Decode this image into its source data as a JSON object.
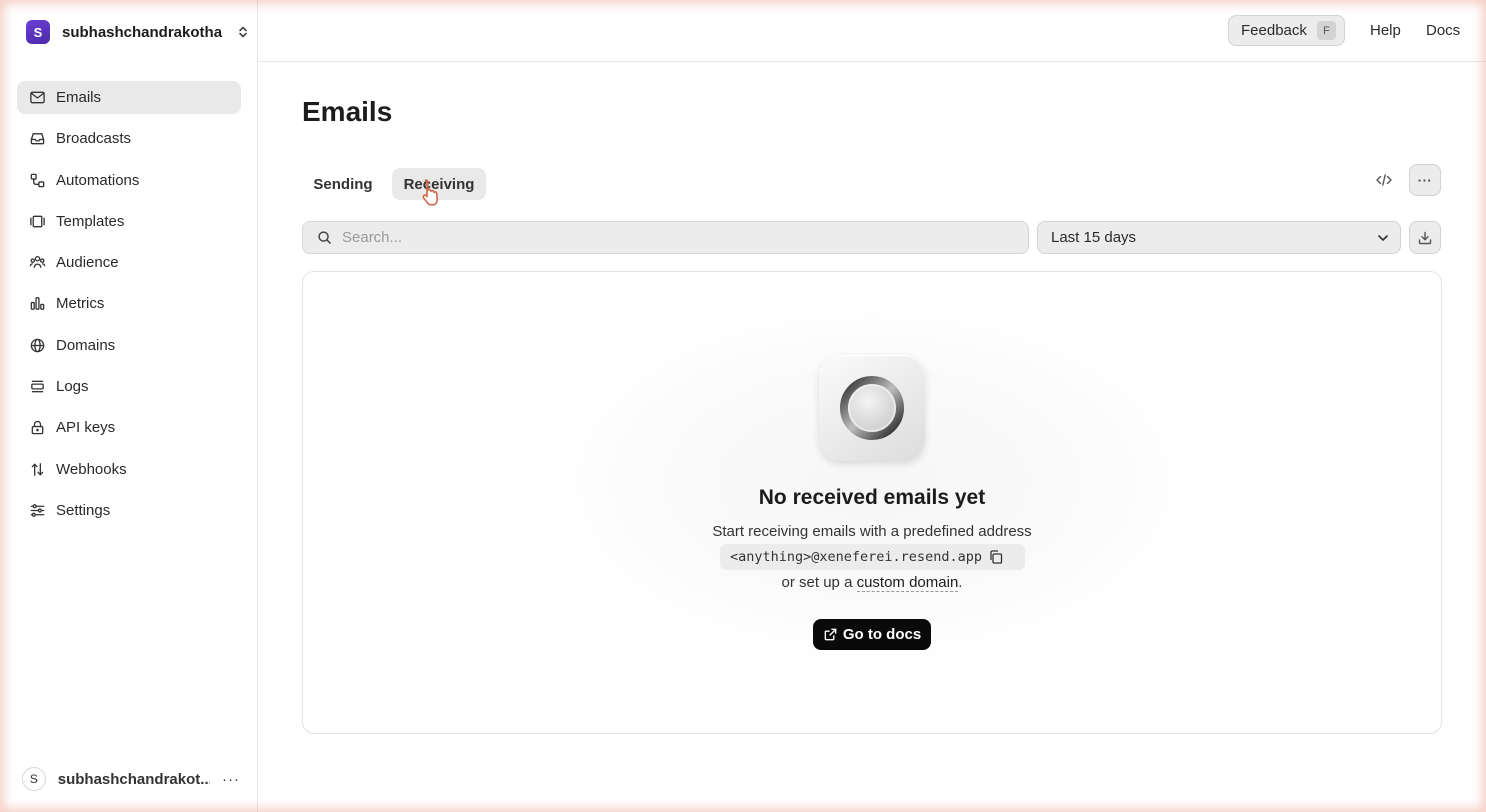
{
  "team": {
    "initial": "S",
    "name": "subhashchandrakotha"
  },
  "sidebar": {
    "items": [
      {
        "label": "Emails",
        "icon": "mail-icon",
        "active": true
      },
      {
        "label": "Broadcasts",
        "icon": "inbox-icon"
      },
      {
        "label": "Automations",
        "icon": "workflow-icon"
      },
      {
        "label": "Templates",
        "icon": "template-icon"
      },
      {
        "label": "Audience",
        "icon": "users-icon"
      },
      {
        "label": "Metrics",
        "icon": "bar-chart-icon"
      },
      {
        "label": "Domains",
        "icon": "globe-icon"
      },
      {
        "label": "Logs",
        "icon": "logs-icon"
      },
      {
        "label": "API keys",
        "icon": "lock-icon"
      },
      {
        "label": "Webhooks",
        "icon": "webhook-icon"
      },
      {
        "label": "Settings",
        "icon": "sliders-icon"
      }
    ]
  },
  "user": {
    "initial": "S",
    "name": "subhashchandrakot...",
    "more": "···"
  },
  "topbar": {
    "feedback_label": "Feedback",
    "feedback_key": "F",
    "help_label": "Help",
    "docs_label": "Docs"
  },
  "main": {
    "title": "Emails",
    "tabs": [
      {
        "label": "Sending"
      },
      {
        "label": "Receiving",
        "active": true
      }
    ],
    "search_placeholder": "Search...",
    "date_range": "Last 15 days",
    "more_label": "···"
  },
  "empty_state": {
    "title": "No received emails yet",
    "subtitle": "Start receiving emails with a predefined address",
    "address": "<anything>@xeneferei.resend.app",
    "or_prefix": "or set up a ",
    "custom_domain_link": "custom domain",
    "or_suffix": ".",
    "docs_button": "Go to docs"
  }
}
